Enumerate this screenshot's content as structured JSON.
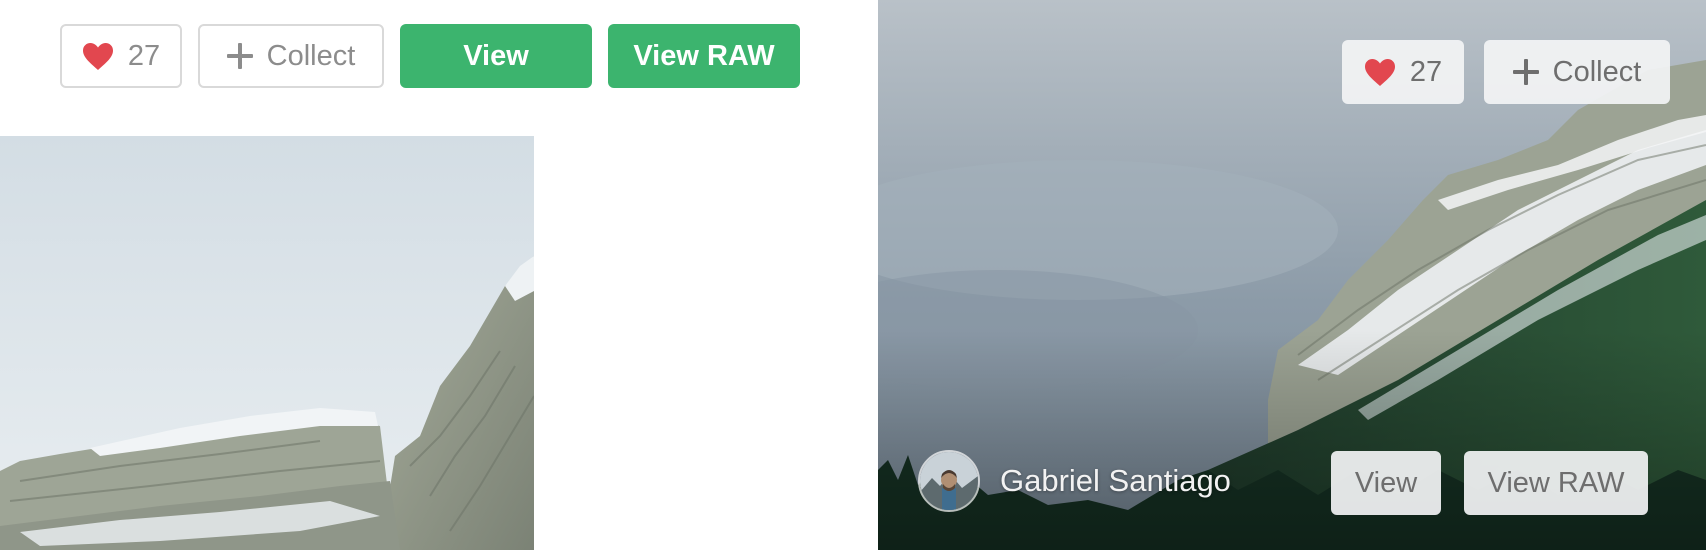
{
  "left_toolbar": {
    "like_count": "27",
    "collect_label": "Collect",
    "view_label": "View",
    "view_raw_label": "View RAW"
  },
  "right_overlay": {
    "like_count": "27",
    "collect_label": "Collect",
    "author_name": "Gabriel Santiago",
    "view_label": "View",
    "view_raw_label": "View RAW"
  },
  "colors": {
    "heart": "#e2474f",
    "primary_green": "#3cb46e",
    "outline_border": "#d9d9d9",
    "muted_text": "#8c8c8c"
  },
  "icons": [
    "heart-icon",
    "plus-icon"
  ]
}
